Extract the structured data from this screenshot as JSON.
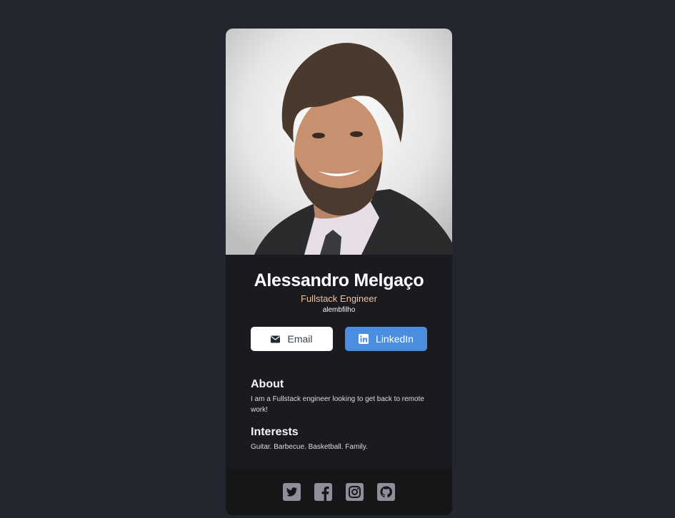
{
  "profile": {
    "name": "Alessandro Melgaço",
    "role": "Fullstack Engineer",
    "handle": "alembfilho"
  },
  "buttons": {
    "email_label": "Email",
    "email_icon": "mail-icon",
    "linkedin_label": "LinkedIn",
    "linkedin_icon": "linkedin-icon"
  },
  "about": {
    "title": "About",
    "text": "I am a Fullstack engineer looking to get back to remote work!"
  },
  "interests": {
    "title": "Interests",
    "text": "Guitar. Barbecue. Basketball. Family."
  },
  "footer": {
    "icons": [
      "twitter-icon",
      "facebook-icon",
      "instagram-icon",
      "github-icon"
    ]
  },
  "colors": {
    "page_bg": "#23252f",
    "card_bg": "#1a1b20",
    "footer_bg": "#161619",
    "accent": "#f3bf99",
    "linkedin": "#4b8ee0",
    "social_icon": "#918e9b"
  }
}
